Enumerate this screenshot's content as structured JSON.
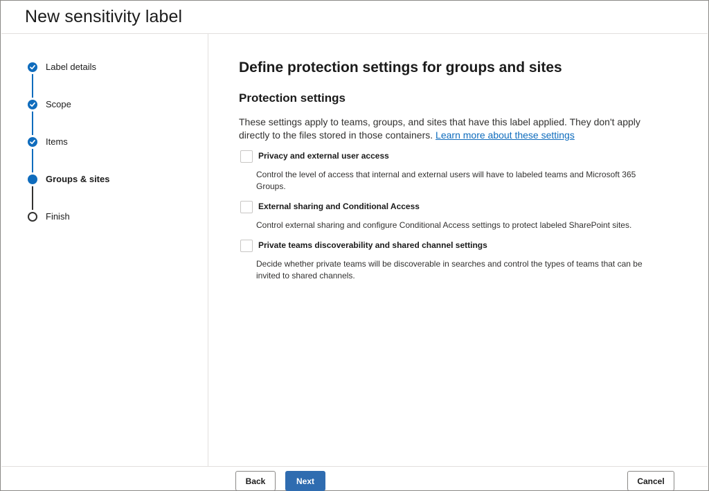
{
  "header": {
    "title": "New sensitivity label"
  },
  "steps": [
    {
      "label": "Label details",
      "state": "completed"
    },
    {
      "label": "Scope",
      "state": "completed"
    },
    {
      "label": "Items",
      "state": "completed"
    },
    {
      "label": "Groups & sites",
      "state": "current"
    },
    {
      "label": "Finish",
      "state": "pending"
    }
  ],
  "main": {
    "heading": "Define protection settings for groups and sites",
    "subheading": "Protection settings",
    "description": "These settings apply to teams, groups, and sites that have this label applied. They don't apply directly to the files stored in those containers.",
    "learn_more": "Learn more about these settings",
    "options": [
      {
        "title": "Privacy and external user access",
        "description": "Control the level of access that internal and external users will have to labeled teams and Microsoft 365 Groups.",
        "checked": false
      },
      {
        "title": "External sharing and Conditional Access",
        "description": "Control external sharing and configure Conditional Access settings to protect labeled SharePoint sites.",
        "checked": false
      },
      {
        "title": "Private teams discoverability and shared channel settings",
        "description": "Decide whether private teams will be discoverable in searches and control the types of teams that can be invited to shared channels.",
        "checked": false
      }
    ]
  },
  "footer": {
    "back": "Back",
    "next": "Next",
    "cancel": "Cancel"
  },
  "colors": {
    "accent": "#0f6cbd",
    "primary_button": "#2f6cb0"
  }
}
